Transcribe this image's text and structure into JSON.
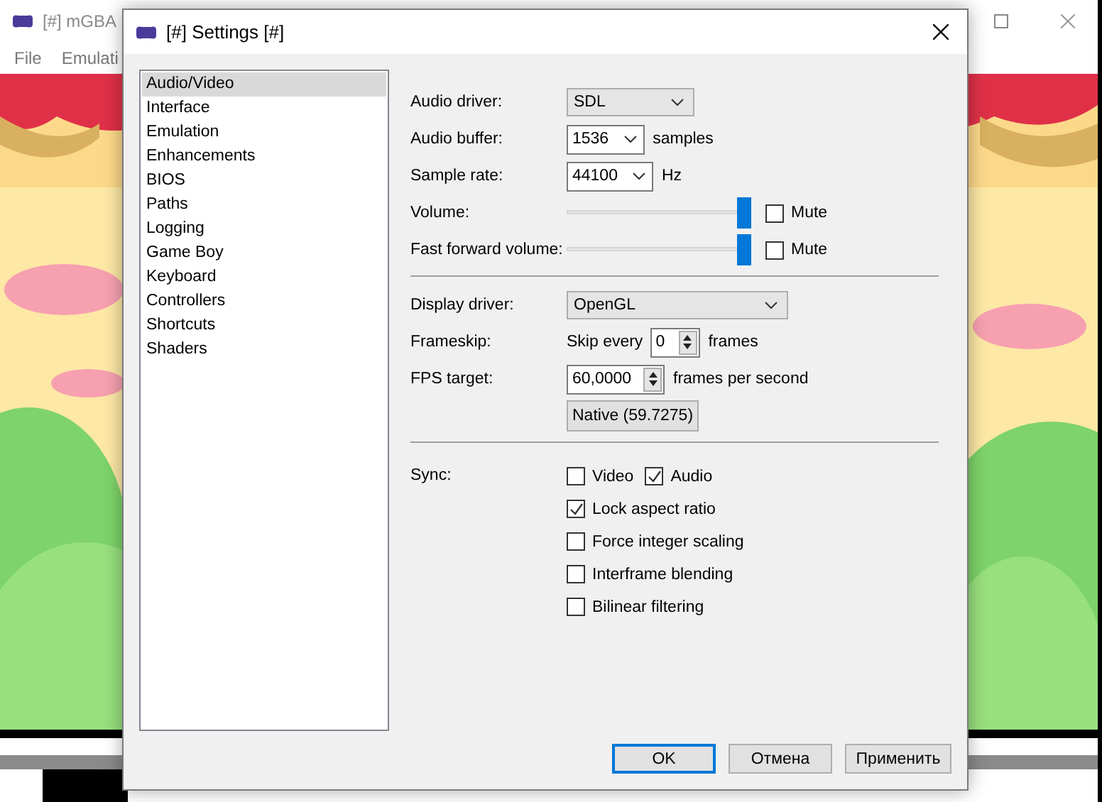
{
  "main_window": {
    "title": "[#] mGBA",
    "menu": [
      "File",
      "Emulati"
    ],
    "picture": {
      "kind": "picture"
    }
  },
  "dialog": {
    "title": "[#] Settings [#]",
    "sidebar": [
      {
        "label": "Audio/Video",
        "selected": true
      },
      {
        "label": "Interface",
        "selected": false
      },
      {
        "label": "Emulation",
        "selected": false
      },
      {
        "label": "Enhancements",
        "selected": false
      },
      {
        "label": "BIOS",
        "selected": false
      },
      {
        "label": "Paths",
        "selected": false
      },
      {
        "label": "Logging",
        "selected": false
      },
      {
        "label": "Game Boy",
        "selected": false
      },
      {
        "label": "Keyboard",
        "selected": false
      },
      {
        "label": "Controllers",
        "selected": false
      },
      {
        "label": "Shortcuts",
        "selected": false
      },
      {
        "label": "Shaders",
        "selected": false
      }
    ],
    "groups": [
      {
        "rows": [
          {
            "kind": "combo",
            "label": "Audio driver:",
            "value": "SDL"
          },
          {
            "kind": "edit_combo",
            "label": "Audio buffer:",
            "value": "1536",
            "unit": "samples"
          },
          {
            "kind": "edit_combo",
            "label": "Sample rate:",
            "value": "44100",
            "unit": "Hz"
          },
          {
            "kind": "slider",
            "label": "Volume:",
            "level": 1,
            "mute": {
              "label": "Mute",
              "checked": false
            }
          },
          {
            "kind": "slider",
            "label": "Fast forward volume:",
            "level": 1,
            "mute": {
              "label": "Mute",
              "checked": false
            }
          }
        ]
      },
      {
        "rows": [
          {
            "kind": "combo",
            "label": "Display driver:",
            "value": "OpenGL"
          },
          {
            "kind": "spin",
            "label": "Frameskip:",
            "prefix": "Skip every",
            "value": "0",
            "unit": "frames"
          },
          {
            "kind": "spin",
            "label": "FPS target:",
            "value": "60,0000",
            "unit": "frames per second"
          },
          {
            "kind": "button",
            "text": "Native (59.7275)"
          }
        ]
      },
      {
        "rows": [
          {
            "kind": "checks",
            "label": "Sync:",
            "lines": [
              [
                {
                  "label": "Video",
                  "checked": false
                },
                {
                  "label": "Audio",
                  "checked": true
                }
              ],
              [
                {
                  "label": "Lock aspect ratio",
                  "checked": true
                }
              ],
              [
                {
                  "label": "Force integer scaling",
                  "checked": false
                }
              ],
              [
                {
                  "label": "Interframe blending",
                  "checked": false
                }
              ],
              [
                {
                  "label": "Bilinear filtering",
                  "checked": false
                }
              ]
            ]
          }
        ]
      }
    ],
    "buttons": [
      {
        "label": "OK",
        "default": true
      },
      {
        "label": "Отмена",
        "default": false
      },
      {
        "label": "Применить",
        "default": false
      }
    ]
  }
}
